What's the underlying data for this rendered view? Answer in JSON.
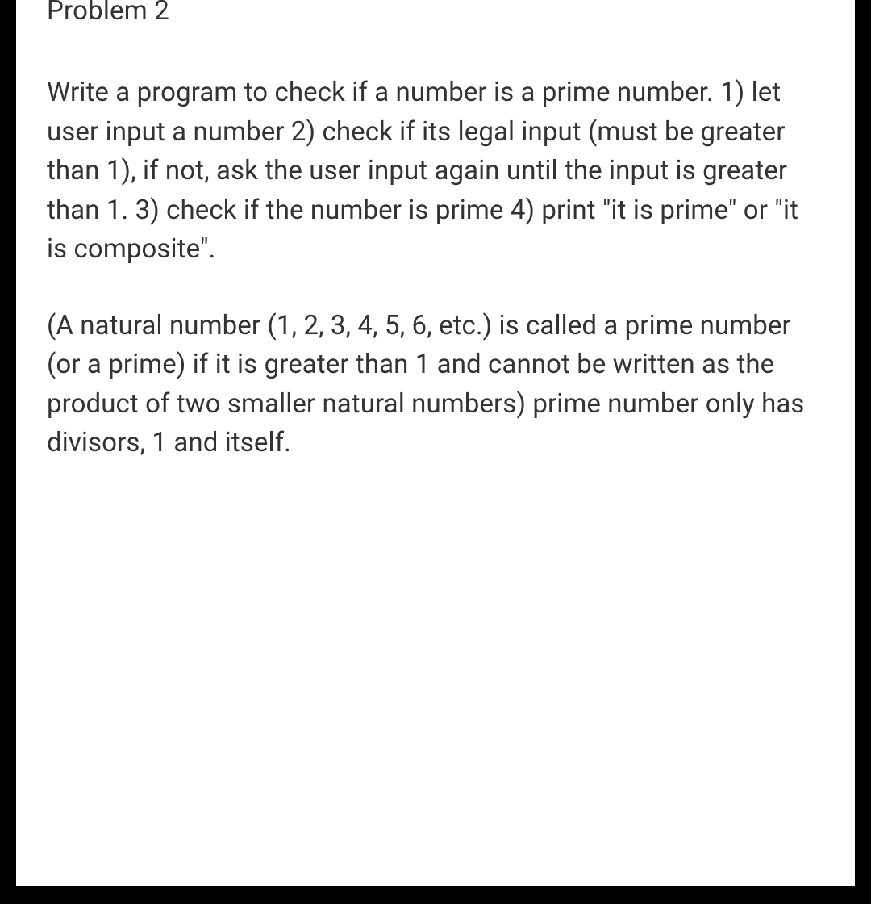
{
  "heading": "Problem 2",
  "paragraph1": "Write a program to check if a number is a prime number. 1) let user input a number 2) check if its legal input (must be greater than 1), if not, ask the user input again until the input is greater than 1.   3) check if the number is prime 4) print \"it is prime\" or \"it is composite\".",
  "paragraph2": "(A natural number (1, 2, 3, 4, 5, 6, etc.) is called a prime number (or a prime) if it is greater than 1 and cannot be written as the product of two smaller natural numbers) prime number only has divisors, 1 and itself."
}
